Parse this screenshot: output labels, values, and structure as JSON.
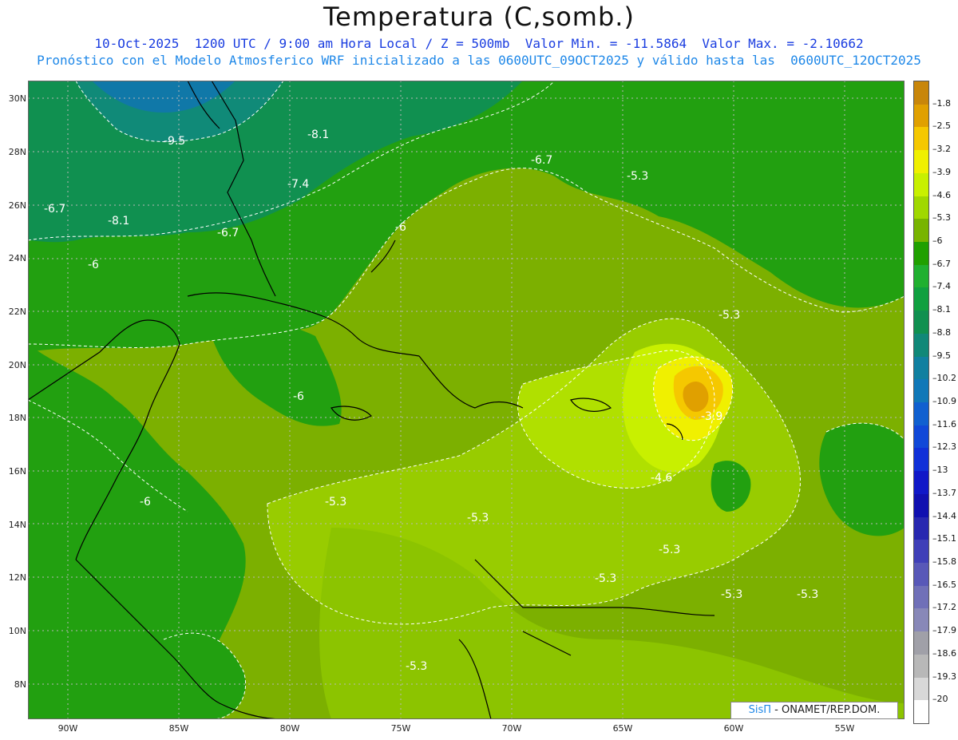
{
  "title": "Temperatura (C,somb.)",
  "subtitle_1": "10-Oct-2025  1200 UTC / 9:00 am Hora Local / Z = 500mb  Valor Min. = -11.5864  Valor Max. = -2.10662",
  "subtitle_2": "Pronóstico con el Modelo Atmosferico WRF inicializado a las 0600UTC_09OCT2025 y válido hasta las  0600UTC_12OCT2025",
  "credit": {
    "brand": "SisΠ",
    "text": " - ONAMET/REP.DOM."
  },
  "map": {
    "lat_labels": [
      "30N",
      "28N",
      "26N",
      "24N",
      "22N",
      "20N",
      "18N",
      "16N",
      "14N",
      "12N",
      "10N",
      "8N"
    ],
    "lon_labels": [
      "90W",
      "85W",
      "80W",
      "75W",
      "70W",
      "65W",
      "60W",
      "55W"
    ],
    "contour_labels": [
      "-9.5",
      "-8.1",
      "-6.7",
      "-8.1",
      "-7.4",
      "-6.7",
      "-6.7",
      "-6",
      "-6",
      "-5.3",
      "-5.3",
      "-6",
      "-6",
      "-5.3",
      "-5.3",
      "-4.6",
      "-3.9",
      "-5.3",
      "-5.3",
      "-5.3",
      "-5.3",
      "-5.3"
    ]
  },
  "colorbar": {
    "labels": [
      "-1.8",
      "-2.5",
      "-3.2",
      "-3.9",
      "-4.6",
      "-5.3",
      "-6",
      "-6.7",
      "-7.4",
      "-8.1",
      "-8.8",
      "-9.5",
      "-10.2",
      "-10.9",
      "-11.6",
      "-12.3",
      "-13",
      "-13.7",
      "-14.4",
      "-15.1",
      "-15.8",
      "-16.5",
      "-17.2",
      "-17.9",
      "-18.6",
      "-19.3",
      "-20"
    ],
    "colors": [
      "#c8860a",
      "#e0a000",
      "#f5c800",
      "#f0f000",
      "#c8f000",
      "#a0d800",
      "#78b400",
      "#20a000",
      "#20b030",
      "#10a040",
      "#109050",
      "#108878",
      "#1080a0",
      "#1078b8",
      "#1060d0",
      "#1048d8",
      "#1030d8",
      "#1018c8",
      "#1010b0",
      "#2828b0",
      "#4040b8",
      "#5858b8",
      "#7070b8",
      "#8888b8",
      "#a0a0a8",
      "#b8b8b8",
      "#d8d8d8",
      "#ffffff"
    ]
  }
}
